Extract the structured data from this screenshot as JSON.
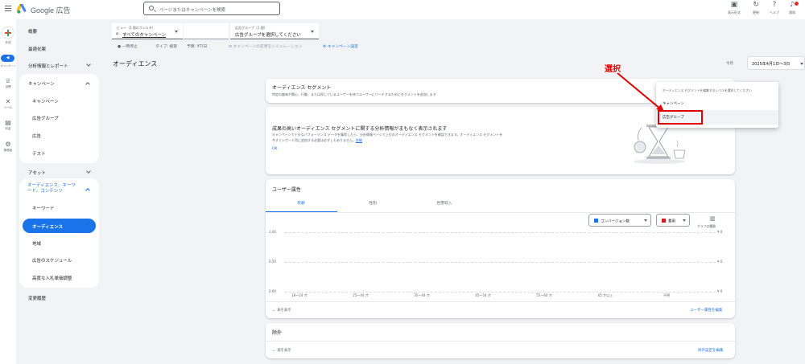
{
  "header": {
    "brand": "Google 広告",
    "search_placeholder": "ページまたはキャンペーンを検索",
    "tools": [
      {
        "label": "表示形式",
        "icon": "appearance-icon"
      },
      {
        "label": "更新",
        "icon": "refresh-icon"
      },
      {
        "label": "ヘルプ",
        "icon": "help-icon"
      },
      {
        "label": "通知",
        "icon": "bell-icon"
      }
    ]
  },
  "rail": {
    "create": "作成",
    "campaigns": "キャンペーン",
    "goals": "目標",
    "tools": "ツール",
    "billing": "料金",
    "admin": "管理者"
  },
  "nav": {
    "overview": "概要",
    "recommendations": "最適化案",
    "insights": "分析情報とレポート",
    "campaigns_header": "キャンペーン",
    "campaign_items": [
      "キャンペーン",
      "広告グループ",
      "広告",
      "テスト"
    ],
    "assets": "アセット",
    "audiences_header": "オーディエンス、キーワード、コンテンツ",
    "audience_items": [
      "キーワード",
      "オーディエンス",
      "地域",
      "広告のスケジュール",
      "高度な入札単価調整"
    ],
    "change_history": "変更履歴"
  },
  "filters": {
    "view_small": "ビュー（2 個のフィルタ）",
    "view_value": "すべてのキャンペーン",
    "adgroup_small": "広告グループ（1 個）",
    "adgroup_value": "広告グループを選択してください",
    "status": "一時停止",
    "type_label": "タイプ: 検索",
    "budget_label": "予算: ¥7/日",
    "simulation": "キャンペーンの変更をシミュレーション",
    "settings": "キャンペーン設定"
  },
  "page": {
    "title": "オーディエンス",
    "today_label": "今月",
    "date_range": "2025年4月1日～3日"
  },
  "segments_card": {
    "title": "オーディエンス セグメント",
    "desc": "特定の趣味や関心、行動、または探しているユーザーを持つユーザーにリーチするためにセグメントを追加します"
  },
  "insight_card": {
    "title": "成果の高いオーディエンス セグメントに関する分析情報がまもなく表示されます",
    "body1": "キャンペーンで十分なパフォーマンス データを獲得したら、分析情報ページで上位のオーディエンス セグメントを確認できます。オーディエンス セグメントを",
    "body2": "今すぐレポート用に追加する必要は必ずしもありません。",
    "detail_link": "詳細",
    "ok": "OK"
  },
  "demographics_card": {
    "title": "ユーザー属性",
    "tabs": [
      "年齢",
      "性別",
      "世帯収入"
    ],
    "metric1": "コンバージョン数",
    "metric2": "費用",
    "chart_type_label": "グラフの種類",
    "show_table": "表を表示",
    "edit_link": "ユーザー属性を編集"
  },
  "exclusions_card": {
    "title": "除外",
    "show_table": "表を表示",
    "edit_link": "除外設定を編集"
  },
  "dropdown_menu": {
    "header": "オーディエンス セグメントを編集するレベルを選択してください",
    "items": [
      "キャンペーン",
      "広告グループ"
    ]
  },
  "annotation": {
    "text": "選択",
    "color": "#e00000"
  },
  "colors": {
    "accent": "#1a73e8",
    "series1": "#1a73e8",
    "series2": "#c5221f"
  },
  "chart_data": {
    "type": "bar",
    "categories": [
      "18～24 才",
      "25～44 才",
      "35～44 才",
      "45～54 才",
      "55～64 才",
      "65 才以上",
      "不明"
    ],
    "series": [
      {
        "name": "コンバージョン数",
        "values": [
          0,
          0,
          0,
          0,
          0,
          0,
          0
        ]
      },
      {
        "name": "費用",
        "values": [
          0,
          0,
          0,
          0,
          0,
          0,
          0
        ]
      }
    ],
    "y_left_ticks": [
      "1.00",
      "0.50",
      "0.00"
    ],
    "y_right_ticks": [
      "¥ 0",
      "¥ 0",
      "¥ 0"
    ],
    "ylim": [
      0,
      1
    ]
  }
}
